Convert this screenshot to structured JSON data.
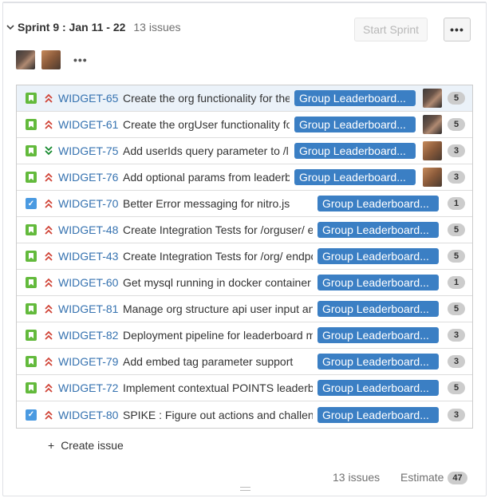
{
  "sprint": {
    "title": "Sprint 9 : Jan 11 - 22",
    "issue_count": "13 issues",
    "start_label": "Start Sprint",
    "more_label": "•••"
  },
  "participants": {
    "more_label": "•••"
  },
  "issues": [
    {
      "key": "WIDGET-65",
      "summary": "Create the org functionality for the",
      "epic": "Group Leaderboard...",
      "points": "5",
      "type": "story",
      "priority": "high",
      "has_avatar": true,
      "selected": true
    },
    {
      "key": "WIDGET-61",
      "summary": "Create the orgUser functionality fo",
      "epic": "Group Leaderboard...",
      "points": "5",
      "type": "story",
      "priority": "high",
      "has_avatar": true,
      "selected": false
    },
    {
      "key": "WIDGET-75",
      "summary": "Add userIds query parameter to /l",
      "epic": "Group Leaderboard...",
      "points": "3",
      "type": "story",
      "priority": "low",
      "has_avatar": true,
      "selected": false
    },
    {
      "key": "WIDGET-76",
      "summary": "Add optional params from leaderb",
      "epic": "Group Leaderboard...",
      "points": "3",
      "type": "story",
      "priority": "high",
      "has_avatar": true,
      "selected": false
    },
    {
      "key": "WIDGET-70",
      "summary": "Better Error messaging for nitro.js",
      "epic": "Group Leaderboard...",
      "points": "1",
      "type": "task",
      "priority": "high",
      "has_avatar": false,
      "selected": false
    },
    {
      "key": "WIDGET-48",
      "summary": "Create Integration Tests for /orguser/ e",
      "epic": "Group Leaderboard...",
      "points": "5",
      "type": "story",
      "priority": "high",
      "has_avatar": false,
      "selected": false
    },
    {
      "key": "WIDGET-43",
      "summary": "Create Integration Tests for /org/ endpo",
      "epic": "Group Leaderboard...",
      "points": "5",
      "type": "story",
      "priority": "high",
      "has_avatar": false,
      "selected": false
    },
    {
      "key": "WIDGET-60",
      "summary": "Get mysql running in docker container",
      "epic": "Group Leaderboard...",
      "points": "1",
      "type": "story",
      "priority": "high",
      "has_avatar": false,
      "selected": false
    },
    {
      "key": "WIDGET-81",
      "summary": "Manage org structure api user input an",
      "epic": "Group Leaderboard...",
      "points": "5",
      "type": "story",
      "priority": "high",
      "has_avatar": false,
      "selected": false
    },
    {
      "key": "WIDGET-82",
      "summary": "Deployment pipeline for leaderboard m",
      "epic": "Group Leaderboard...",
      "points": "3",
      "type": "story",
      "priority": "high",
      "has_avatar": false,
      "selected": false
    },
    {
      "key": "WIDGET-79",
      "summary": "Add embed tag parameter support",
      "epic": "Group Leaderboard...",
      "points": "3",
      "type": "story",
      "priority": "high",
      "has_avatar": false,
      "selected": false
    },
    {
      "key": "WIDGET-72",
      "summary": "Implement contextual POINTS leaderb",
      "epic": "Group Leaderboard...",
      "points": "5",
      "type": "story",
      "priority": "high",
      "has_avatar": false,
      "selected": false
    },
    {
      "key": "WIDGET-80",
      "summary": "SPIKE : Figure out actions and challen",
      "epic": "Group Leaderboard...",
      "points": "3",
      "type": "task",
      "priority": "high",
      "has_avatar": false,
      "selected": false
    }
  ],
  "create_issue": {
    "plus": "+",
    "label": "Create issue"
  },
  "footer": {
    "issue_count": "13 issues",
    "estimate_label": "Estimate",
    "estimate_value": "47"
  },
  "colors": {
    "epic": "#3b7fc4",
    "story": "#63ba3c",
    "task": "#4a9ae1",
    "priority_high": "#d04437",
    "priority_low": "#14892c",
    "link": "#3572b0"
  }
}
